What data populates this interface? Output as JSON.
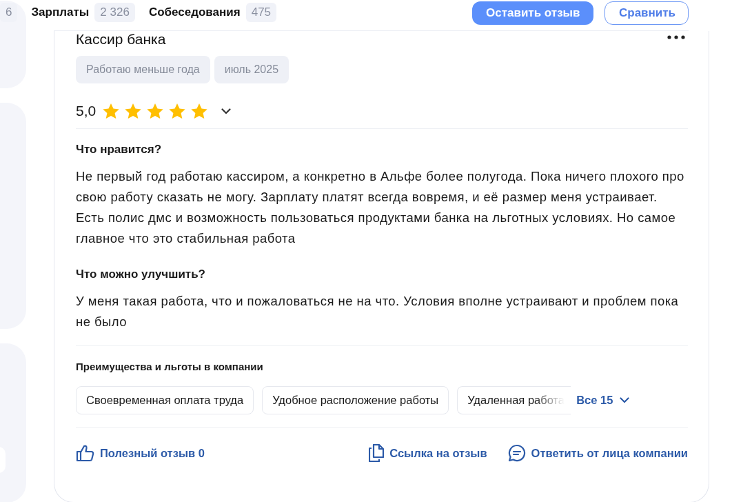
{
  "top_bar": {
    "tabs": [
      {
        "count": "6"
      },
      {
        "label": "Зарплаты",
        "count": "2 326"
      },
      {
        "label": "Собеседования",
        "count": "475"
      }
    ],
    "buttons": [
      {
        "kind": "primary",
        "label": "Оставить отзыв"
      },
      {
        "kind": "outline",
        "label": "Сравнить"
      }
    ]
  },
  "review": {
    "title": "Кассир банка",
    "tags": [
      "Работаю меньше года",
      "июль 2025"
    ],
    "rating": "5,0",
    "stars": 5,
    "sections": [
      {
        "heading": "Что нравится?",
        "text": "Не первый год работаю кассиром, а конкретно в Альфе более полугода. Пока ничего плохого про свою работу сказать не могу. Зарплату платят всегда вовремя, и её размер меня устраивает. Есть полис дмс и возможность пользоваться продуктами банка на льготных условиях. Но самое главное что это стабильная работа"
      },
      {
        "heading": "Что можно улучшить?",
        "text": "У меня такая работа, что и пожаловаться не на что. Условия вполне устраивают и проблем пока не было"
      }
    ],
    "benefits": {
      "heading": "Преимущества и льготы в компании",
      "items": [
        "Своевременная оплата труда",
        "Удобное расположение работы",
        "Удаленная работа"
      ],
      "more_label": "Все 15"
    },
    "actions": [
      {
        "kind": "like",
        "label": "Полезный отзыв 0"
      },
      {
        "kind": "link",
        "label": "Ссылка на отзыв"
      },
      {
        "kind": "reply",
        "label": "Ответить от лица компании"
      }
    ]
  }
}
